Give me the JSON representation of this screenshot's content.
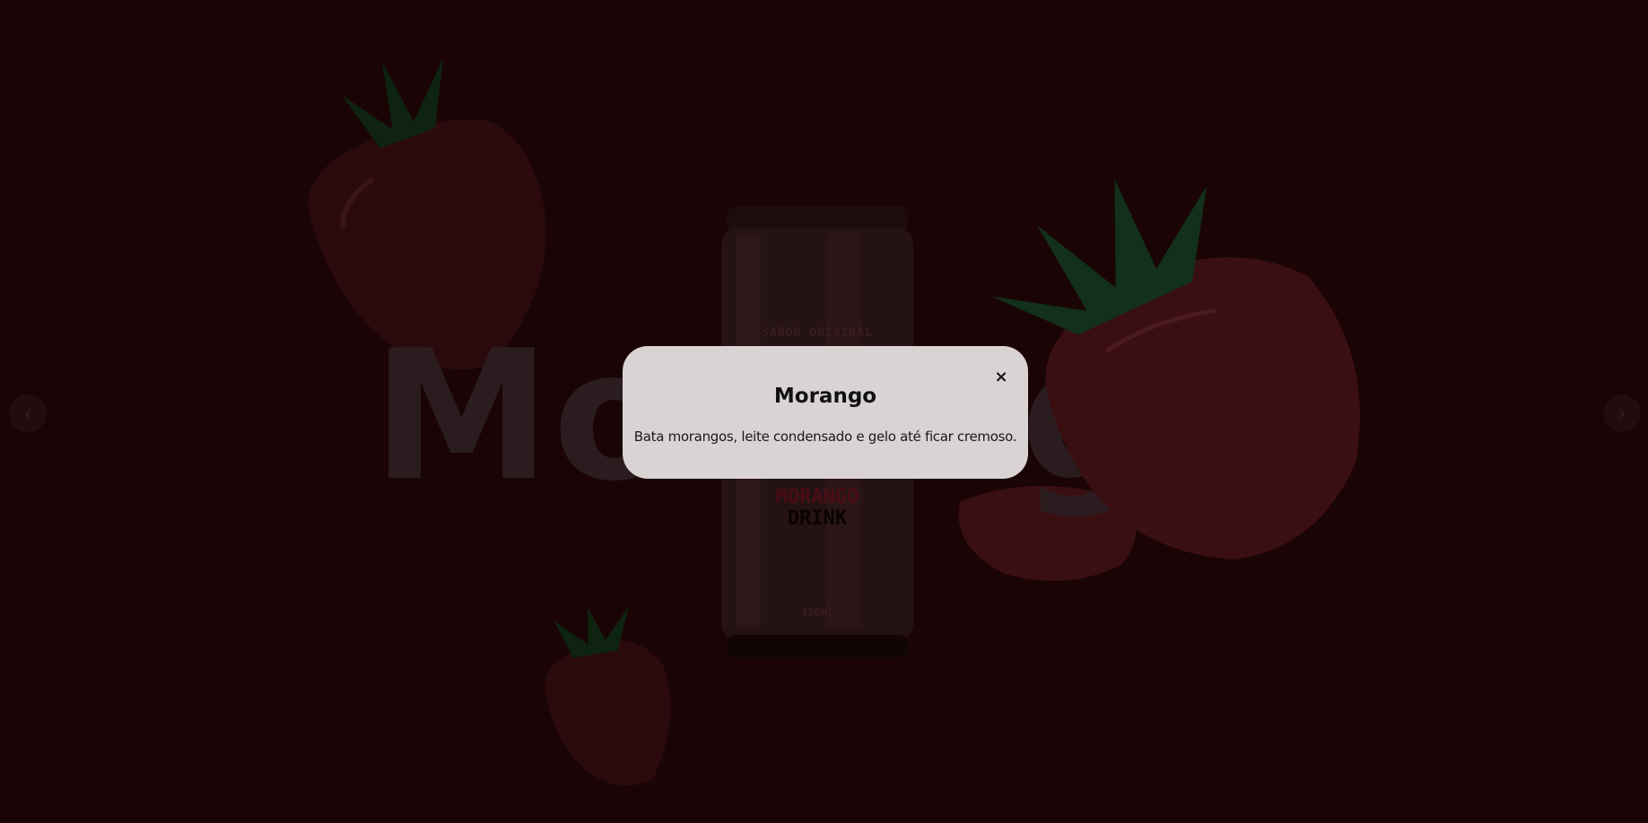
{
  "page": {
    "hero_text": "Morango",
    "colors": {
      "background": "#1a0406",
      "hero_text": "#2b1d1f",
      "modal_bg": "#d9d3d4"
    }
  },
  "can": {
    "top_label": "SABOR ORIGINAL",
    "name_line1": "MORANGO",
    "name_line2": "DRINK",
    "volume": "350ml"
  },
  "nav": {
    "prev_icon": "chevron-left-icon",
    "next_icon": "chevron-right-icon",
    "prev_glyph": "‹",
    "next_glyph": "›"
  },
  "modal": {
    "close_glyph": "×",
    "title": "Morango",
    "text": "Bata morangos, leite condensado e gelo até ficar cremoso."
  }
}
